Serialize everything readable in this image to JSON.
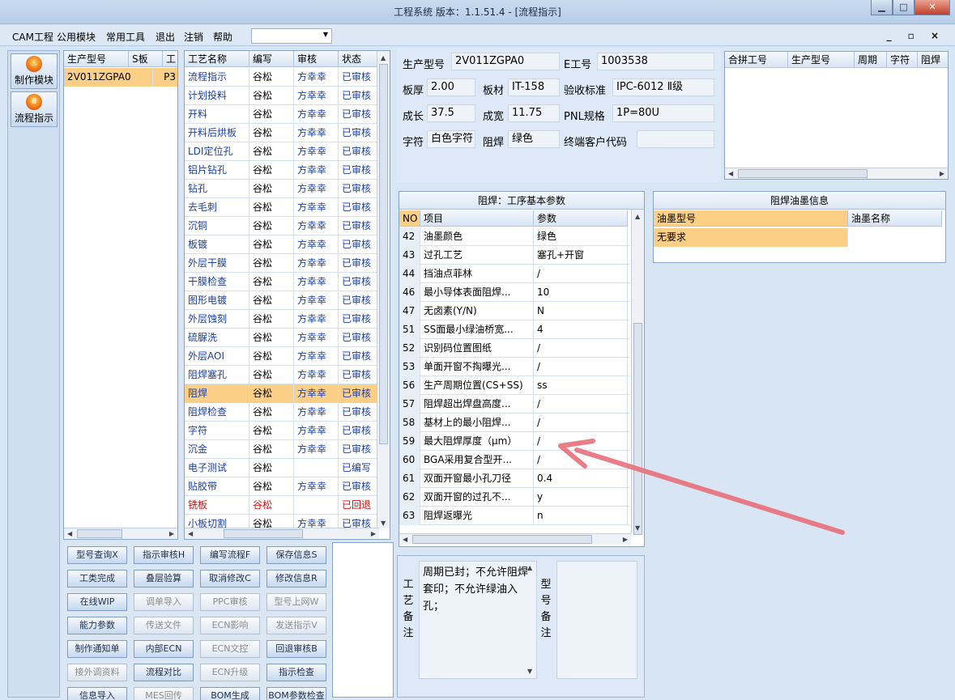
{
  "window": {
    "title": "工程系统   版本：1.1.51.4 - [流程指示]"
  },
  "menu": {
    "items": [
      "CAM工程",
      "公用模块",
      "常用工具",
      "退出",
      "注销",
      "帮助"
    ],
    "mdi_controls": "_ ▫ ×"
  },
  "sidebar": {
    "buttons": [
      "制作模块",
      "流程指示"
    ]
  },
  "models": {
    "headers": [
      "生产型号",
      "S板",
      "工"
    ],
    "rows": [
      {
        "model": "2V011ZGPA0",
        "flag": "P3"
      }
    ]
  },
  "process": {
    "headers": [
      "工艺名称",
      "编写",
      "审核",
      "状态"
    ],
    "rows": [
      [
        "流程指示",
        "谷松",
        "方幸幸",
        "已审核"
      ],
      [
        "计划投料",
        "谷松",
        "方幸幸",
        "已审核"
      ],
      [
        "开料",
        "谷松",
        "方幸幸",
        "已审核"
      ],
      [
        "开料后烘板",
        "谷松",
        "方幸幸",
        "已审核"
      ],
      [
        "LDI定位孔",
        "谷松",
        "方幸幸",
        "已审核"
      ],
      [
        "铝片钻孔",
        "谷松",
        "方幸幸",
        "已审核"
      ],
      [
        "钻孔",
        "谷松",
        "方幸幸",
        "已审核"
      ],
      [
        "去毛刺",
        "谷松",
        "方幸幸",
        "已审核"
      ],
      [
        "沉铜",
        "谷松",
        "方幸幸",
        "已审核"
      ],
      [
        "板镀",
        "谷松",
        "方幸幸",
        "已审核"
      ],
      [
        "外层干膜",
        "谷松",
        "方幸幸",
        "已审核"
      ],
      [
        "干膜检查",
        "谷松",
        "方幸幸",
        "已审核"
      ],
      [
        "图形电镀",
        "谷松",
        "方幸幸",
        "已审核"
      ],
      [
        "外层蚀刻",
        "谷松",
        "方幸幸",
        "已审核"
      ],
      [
        "硫脲洗",
        "谷松",
        "方幸幸",
        "已审核"
      ],
      [
        "外层AOI",
        "谷松",
        "方幸幸",
        "已审核"
      ],
      [
        "阻焊塞孔",
        "谷松",
        "方幸幸",
        "已审核"
      ],
      [
        "阻焊",
        "谷松",
        "方幸幸",
        "已审核"
      ],
      [
        "阻焊检查",
        "谷松",
        "方幸幸",
        "已审核"
      ],
      [
        "字符",
        "谷松",
        "方幸幸",
        "已审核"
      ],
      [
        "沉金",
        "谷松",
        "方幸幸",
        "已审核"
      ],
      [
        "电子测试",
        "谷松",
        "",
        "已编写"
      ],
      [
        "贴胶带",
        "谷松",
        "方幸幸",
        "已审核"
      ],
      [
        "铣板",
        "谷松",
        "",
        "已回退"
      ],
      [
        "小板切割",
        "谷松",
        "方幸幸",
        "已审核"
      ]
    ],
    "selected_index": 17,
    "red_index": 23
  },
  "product": {
    "model_label": "生产型号",
    "model": "2V011ZGPA0",
    "eno_label": "E工号",
    "eno": "1003538",
    "thick_label": "板厚",
    "thick": "2.00",
    "mat_label": "板材",
    "mat": "IT-158",
    "std_label": "验收标准",
    "std": "IPC-6012 Ⅱ级",
    "len_label": "成长",
    "len": "37.5",
    "wid_label": "成宽",
    "wid": "11.75",
    "pnl_label": "PNL规格",
    "pnl": "1P=80U",
    "char_label": "字符",
    "char": "白色字符",
    "mask_label": "阻焊",
    "mask": "绿色",
    "cust_label": "终端客户代码",
    "cust": ""
  },
  "merge": {
    "headers": [
      "合拼工号",
      "生产型号",
      "周期",
      "字符",
      "阻焊"
    ]
  },
  "params": {
    "title": "阻焊：工序基本参数",
    "headers": [
      "NO",
      "项目",
      "参数"
    ],
    "rows": [
      [
        "42",
        "油墨颜色",
        "绿色"
      ],
      [
        "43",
        "过孔工艺",
        "塞孔+开窗"
      ],
      [
        "44",
        "挡油点菲林",
        "/"
      ],
      [
        "46",
        "最小导体表面阻焊...",
        "10"
      ],
      [
        "47",
        "无卤素(Y/N)",
        "N"
      ],
      [
        "51",
        "SS面最小绿油桥宽...",
        "4"
      ],
      [
        "52",
        "识别码位置图纸",
        "/"
      ],
      [
        "53",
        "单面开窗不掏曝光...",
        "/"
      ],
      [
        "56",
        "生产周期位置(CS+SS)",
        "ss"
      ],
      [
        "57",
        "阻焊超出焊盘高度...",
        "/"
      ],
      [
        "58",
        "基材上的最小阻焊...",
        "/"
      ],
      [
        "59",
        "最大阻焊厚度（μm）",
        "/"
      ],
      [
        "60",
        "BGA采用复合型开...",
        "/"
      ],
      [
        "61",
        "双面开窗最小孔刀径",
        "0.4"
      ],
      [
        "62",
        "双面开窗的过孔不...",
        "y"
      ],
      [
        "63",
        "阻焊返曝光",
        "n"
      ]
    ]
  },
  "ink": {
    "title": "阻焊油墨信息",
    "headers": [
      "油墨型号",
      "油墨名称"
    ],
    "rows": [
      [
        "无要求",
        ""
      ]
    ]
  },
  "buttons": [
    {
      "label": "型号查询X",
      "enabled": true
    },
    {
      "label": "指示审核H",
      "enabled": true
    },
    {
      "label": "编写流程F",
      "enabled": true
    },
    {
      "label": "保存信息S",
      "enabled": true
    },
    {
      "label": "工类完成",
      "enabled": true
    },
    {
      "label": "叠层验算",
      "enabled": true
    },
    {
      "label": "取消修改C",
      "enabled": true
    },
    {
      "label": "修改信息R",
      "enabled": true
    },
    {
      "label": "在线WIP",
      "enabled": true
    },
    {
      "label": "调单导入",
      "enabled": false
    },
    {
      "label": "PPC审核",
      "enabled": false
    },
    {
      "label": "型号上网W",
      "enabled": false
    },
    {
      "label": "能力参数",
      "enabled": true
    },
    {
      "label": "传送文件",
      "enabled": false
    },
    {
      "label": "ECN影响",
      "enabled": false
    },
    {
      "label": "发送指示V",
      "enabled": false
    },
    {
      "label": "制作通知单",
      "enabled": true
    },
    {
      "label": "内部ECN",
      "enabled": true
    },
    {
      "label": "ECN文控",
      "enabled": false
    },
    {
      "label": "回退审核B",
      "enabled": true
    },
    {
      "label": "接外调资料",
      "enabled": false
    },
    {
      "label": "流程对比",
      "enabled": true
    },
    {
      "label": "ECN升级",
      "enabled": false
    },
    {
      "label": "指示检查",
      "enabled": true
    },
    {
      "label": "信息导入",
      "enabled": true
    },
    {
      "label": "MES回传",
      "enabled": false
    },
    {
      "label": "BOM生成",
      "enabled": true
    },
    {
      "label": "BOM参数检查",
      "enabled": true
    }
  ],
  "remarks": {
    "process_label": "工艺备注",
    "process_text": "周期已封；不允许阻焊套印；不允许绿油入孔；",
    "model_label": "型号备注",
    "model_text": ""
  },
  "colors": {
    "selected_row": "#fbcf86",
    "link_text": "#1a3fa8",
    "red_text": "#d01010",
    "annotation_arrow": "#e8707a"
  }
}
